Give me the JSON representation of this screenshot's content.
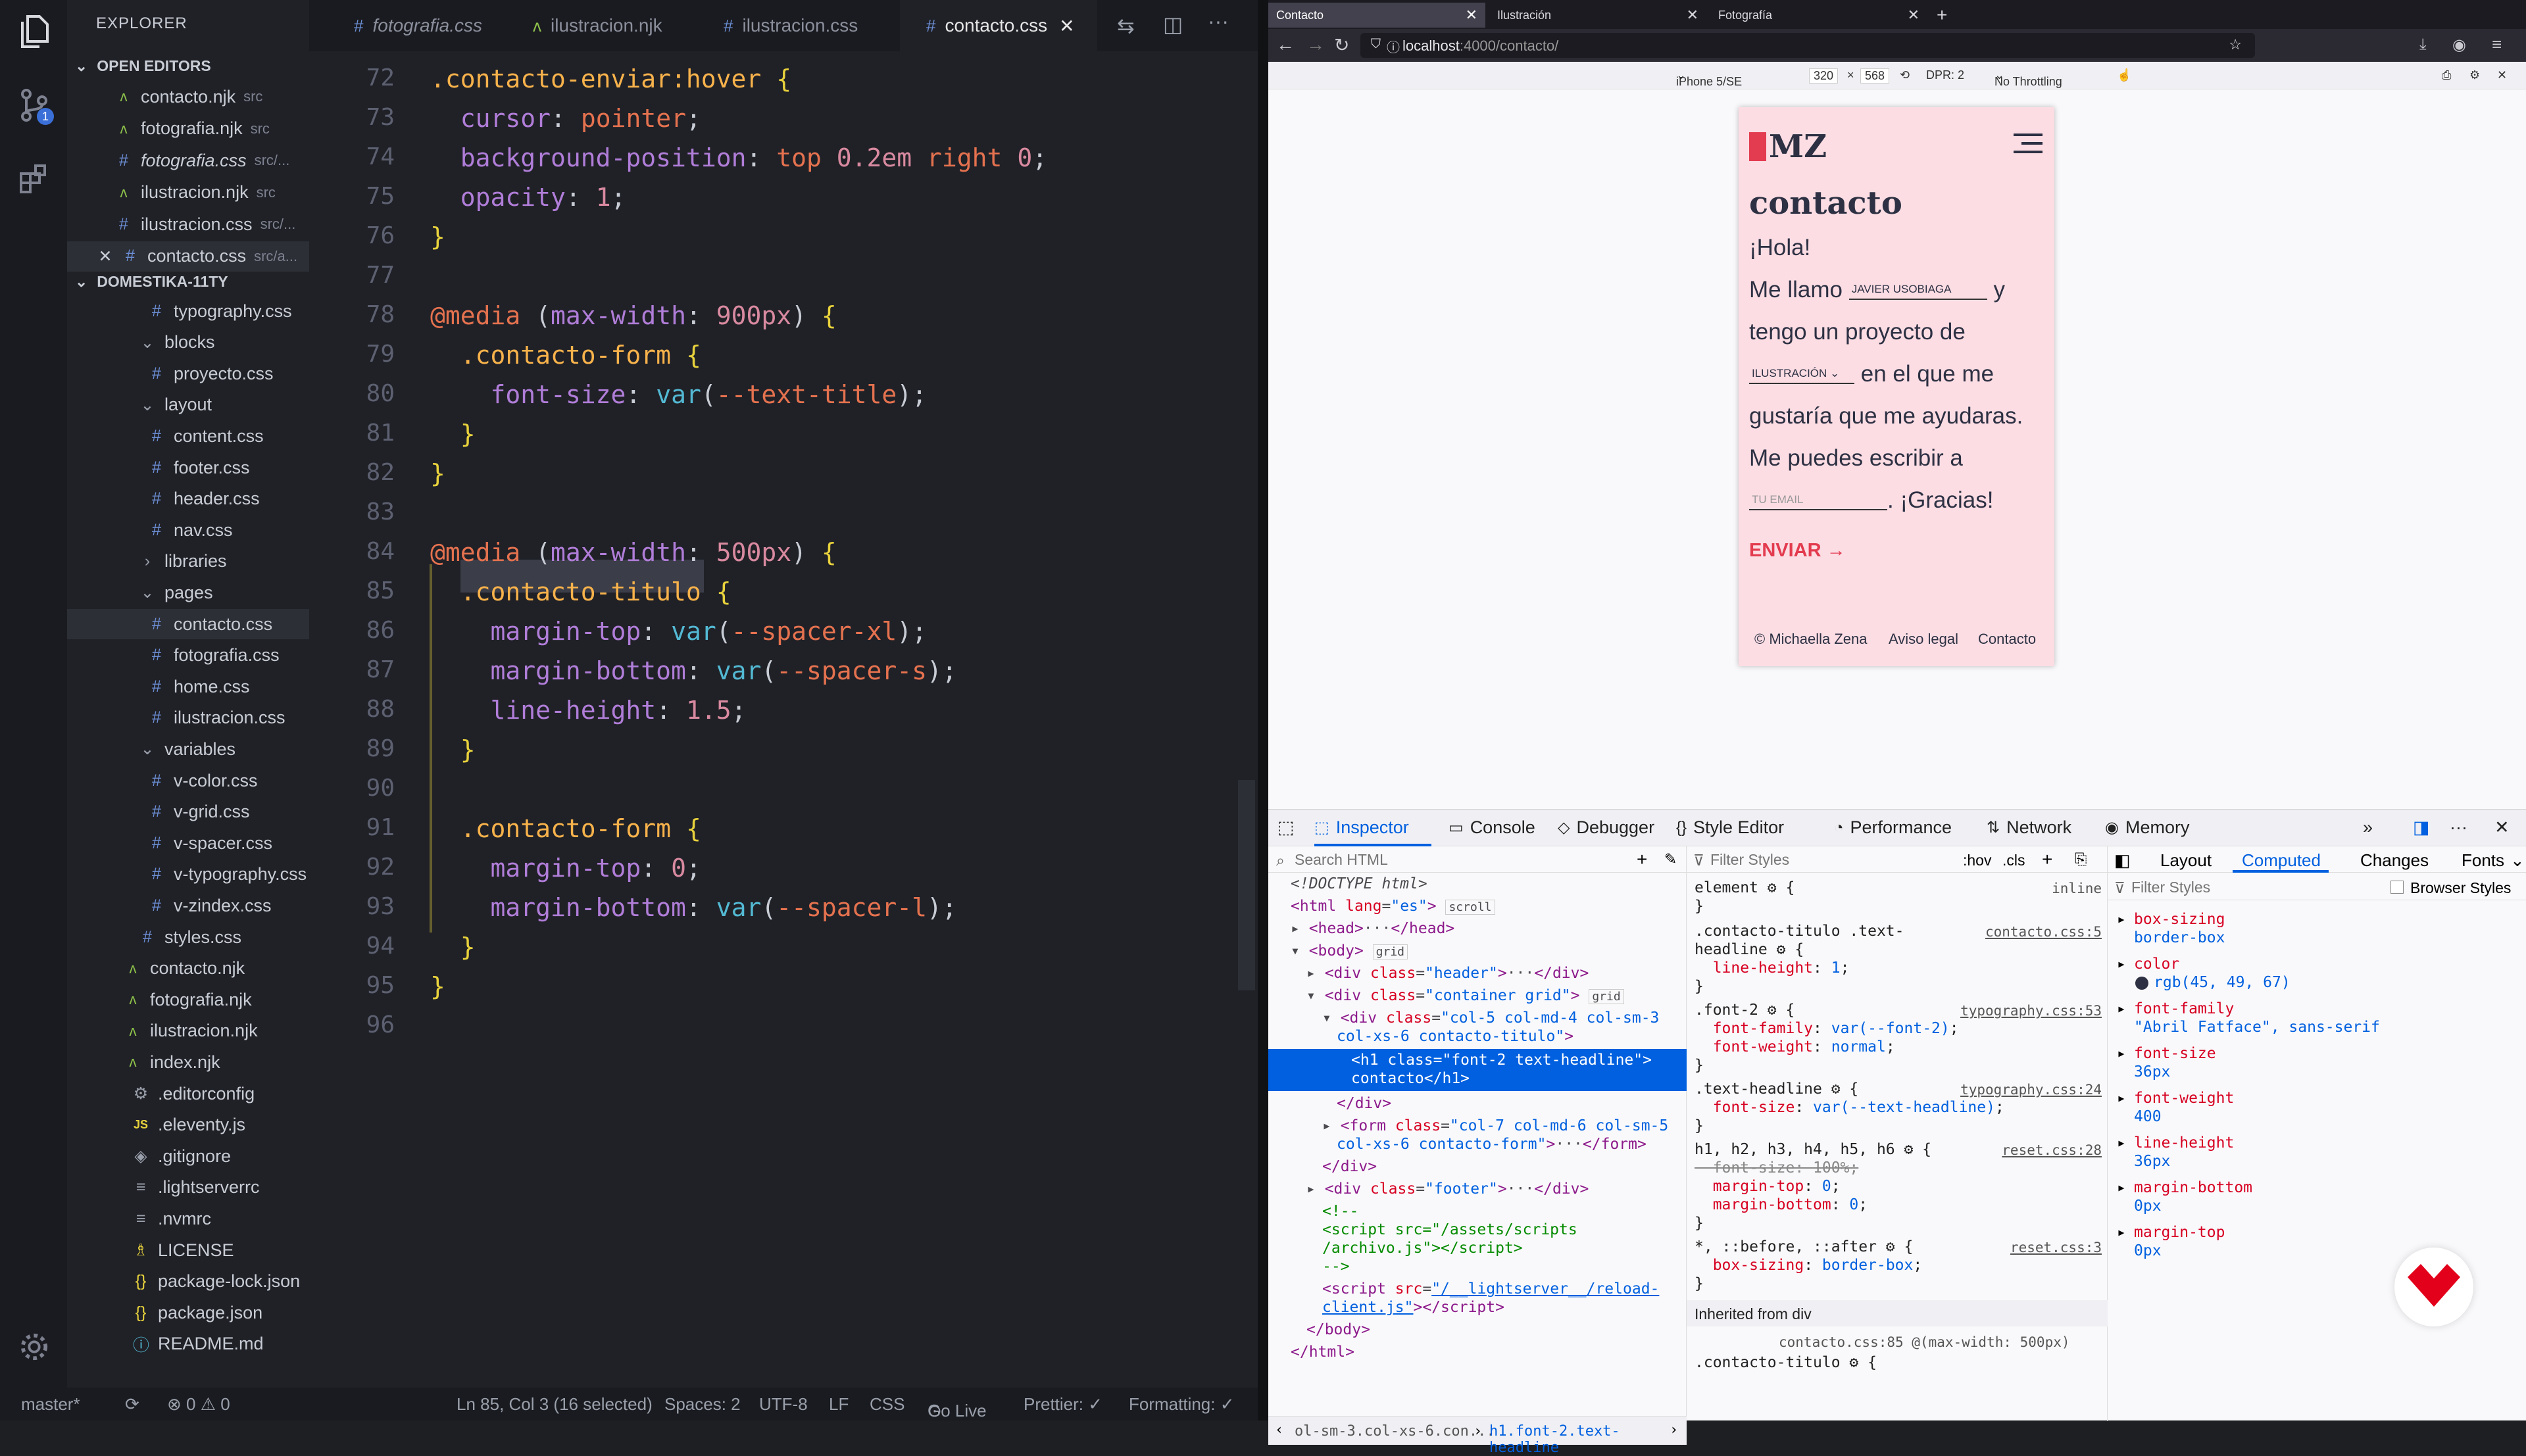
{
  "activity_bar": {
    "items": [
      "files-icon",
      "source-control-icon",
      "extensions-icon"
    ],
    "badge": "1"
  },
  "explorer": {
    "title": "EXPLORER",
    "open_editors_title": "OPEN EDITORS",
    "open_editors": [
      {
        "icon": "njk",
        "name": "contacto.njk",
        "sub": "src"
      },
      {
        "icon": "njk",
        "name": "fotografia.njk",
        "sub": "src"
      },
      {
        "icon": "css",
        "name": "fotografia.css",
        "sub": "src/...",
        "italic": true
      },
      {
        "icon": "njk",
        "name": "ilustracion.njk",
        "sub": "src"
      },
      {
        "icon": "css",
        "name": "ilustracion.css",
        "sub": "src/..."
      },
      {
        "icon": "css",
        "name": "contacto.css",
        "sub": "src/a...",
        "close": true
      }
    ],
    "project_title": "DOMESTIKA-11TY",
    "tree": [
      {
        "name": "typography.css",
        "type": "css",
        "indent": 2
      },
      {
        "name": "blocks",
        "type": "folder",
        "indent": 1
      },
      {
        "name": "proyecto.css",
        "type": "css",
        "indent": 2
      },
      {
        "name": "layout",
        "type": "folder",
        "indent": 1
      },
      {
        "name": "content.css",
        "type": "css",
        "indent": 2
      },
      {
        "name": "footer.css",
        "type": "css",
        "indent": 2
      },
      {
        "name": "header.css",
        "type": "css",
        "indent": 2
      },
      {
        "name": "nav.css",
        "type": "css",
        "indent": 2
      },
      {
        "name": "libraries",
        "type": "folder-closed",
        "indent": 1
      },
      {
        "name": "pages",
        "type": "folder",
        "indent": 1
      },
      {
        "name": "contacto.css",
        "type": "css",
        "indent": 2,
        "selected": true
      },
      {
        "name": "fotografia.css",
        "type": "css",
        "indent": 2
      },
      {
        "name": "home.css",
        "type": "css",
        "indent": 2
      },
      {
        "name": "ilustracion.css",
        "type": "css",
        "indent": 2
      },
      {
        "name": "variables",
        "type": "folder",
        "indent": 1
      },
      {
        "name": "v-color.css",
        "type": "css",
        "indent": 2
      },
      {
        "name": "v-grid.css",
        "type": "css",
        "indent": 2
      },
      {
        "name": "v-spacer.css",
        "type": "css",
        "indent": 2
      },
      {
        "name": "v-typography.css",
        "type": "css",
        "indent": 2
      },
      {
        "name": "v-zindex.css",
        "type": "css",
        "indent": 2
      },
      {
        "name": "styles.css",
        "type": "css",
        "indent": 1
      },
      {
        "name": "contacto.njk",
        "type": "njk",
        "indent": 0
      },
      {
        "name": "fotografia.njk",
        "type": "njk",
        "indent": 0
      },
      {
        "name": "ilustracion.njk",
        "type": "njk",
        "indent": 0
      },
      {
        "name": "index.njk",
        "type": "njk",
        "indent": 0
      },
      {
        "name": ".editorconfig",
        "type": "gear",
        "indent": -1
      },
      {
        "name": ".eleventy.js",
        "type": "js",
        "indent": -1
      },
      {
        "name": ".gitignore",
        "type": "git",
        "indent": -1
      },
      {
        "name": ".lightserverrc",
        "type": "lines",
        "indent": -1
      },
      {
        "name": ".nvmrc",
        "type": "lines",
        "indent": -1
      },
      {
        "name": "LICENSE",
        "type": "license",
        "indent": -1
      },
      {
        "name": "package-lock.json",
        "type": "json",
        "indent": -1
      },
      {
        "name": "package.json",
        "type": "json",
        "indent": -1
      },
      {
        "name": "README.md",
        "type": "info",
        "indent": -1
      }
    ]
  },
  "tabs": [
    {
      "icon": "#",
      "name": "fotografia.css",
      "italic": true
    },
    {
      "icon": "njk",
      "name": "ilustracion.njk"
    },
    {
      "icon": "#",
      "name": "ilustracion.css"
    },
    {
      "icon": "#",
      "name": "contacto.css",
      "active": true
    }
  ],
  "code": {
    "start": 72,
    "lines": [
      ".contacto-enviar:hover {",
      "  cursor: pointer;",
      "  background-position: top 0.2em right 0;",
      "  opacity: 1;",
      "}",
      "",
      "@media (max-width: 900px) {",
      "  .contacto-form {",
      "    font-size: var(--text-title);",
      "  }",
      "}",
      "",
      "@media (max-width: 500px) {",
      "  .contacto-titulo {",
      "    margin-top: var(--spacer-xl);",
      "    margin-bottom: var(--spacer-s);",
      "    line-height: 1.5;",
      "  }",
      "",
      "  .contacto-form {",
      "    margin-top: 0;",
      "    margin-bottom: var(--spacer-l);",
      "  }",
      "}",
      ""
    ]
  },
  "status": {
    "branch": "master*",
    "problems": "⊗ 0 ⚠ 0",
    "position": "Ln 85, Col 3 (16 selected)",
    "spaces": "Spaces: 2",
    "encoding": "UTF-8",
    "eol": "LF",
    "lang": "CSS",
    "golive": "Go Live",
    "prettier": "Prettier: ✓",
    "formatting": "Formatting: ✓"
  },
  "browser": {
    "tabs": [
      "Contacto",
      "Ilustración",
      "Fotografía"
    ],
    "url_host": "localhost",
    "url_path": ":4000/contacto/",
    "device": "iPhone 5/SE",
    "width": "320",
    "height": "568",
    "dpr": "DPR: 2",
    "throttle": "No Throttling",
    "site": {
      "logo": "MZ",
      "title": "contacto",
      "hola": "¡Hola!",
      "me_llamo": "Me llamo",
      "name_placeholder": "JAVIER USOBIAGA",
      "y": "y",
      "tengo": "tengo un proyecto de",
      "select": "ILUSTRACIÓN",
      "en_el": "en el que me",
      "gustaria": "gustaría que me ayudaras.",
      "puedes": "Me puedes escribir a",
      "email_placeholder": "TU EMAIL",
      "gracias": ". ¡Gracias!",
      "enviar": "ENVIAR →",
      "footer": [
        "© Michaella Zena",
        "Aviso legal",
        "Contacto"
      ]
    }
  },
  "devtools": {
    "tabs": [
      "Inspector",
      "Console",
      "Debugger",
      "Style Editor",
      "Performance",
      "Network",
      "Memory"
    ],
    "search_placeholder": "Search HTML",
    "filter_placeholder": "Filter Styles",
    "hov": ":hov",
    "cls": ".cls",
    "right_tabs": [
      "Layout",
      "Computed",
      "Changes",
      "Fonts"
    ],
    "browser_styles": "Browser Styles",
    "breadcrumb": [
      "ol-sm-3.col-xs-6.con...",
      "h1.font-2.text-headline"
    ],
    "computed": [
      {
        "name": "box-sizing",
        "value": "border-box"
      },
      {
        "name": "color",
        "value": "rgb(45, 49, 67)"
      },
      {
        "name": "font-family",
        "value": "\"Abril Fatface\", sans-serif"
      },
      {
        "name": "font-size",
        "value": "36px"
      },
      {
        "name": "font-weight",
        "value": "400"
      },
      {
        "name": "line-height",
        "value": "36px"
      },
      {
        "name": "margin-bottom",
        "value": "0px"
      },
      {
        "name": "margin-top",
        "value": "0px"
      }
    ],
    "inherited": "Inherited from div"
  }
}
